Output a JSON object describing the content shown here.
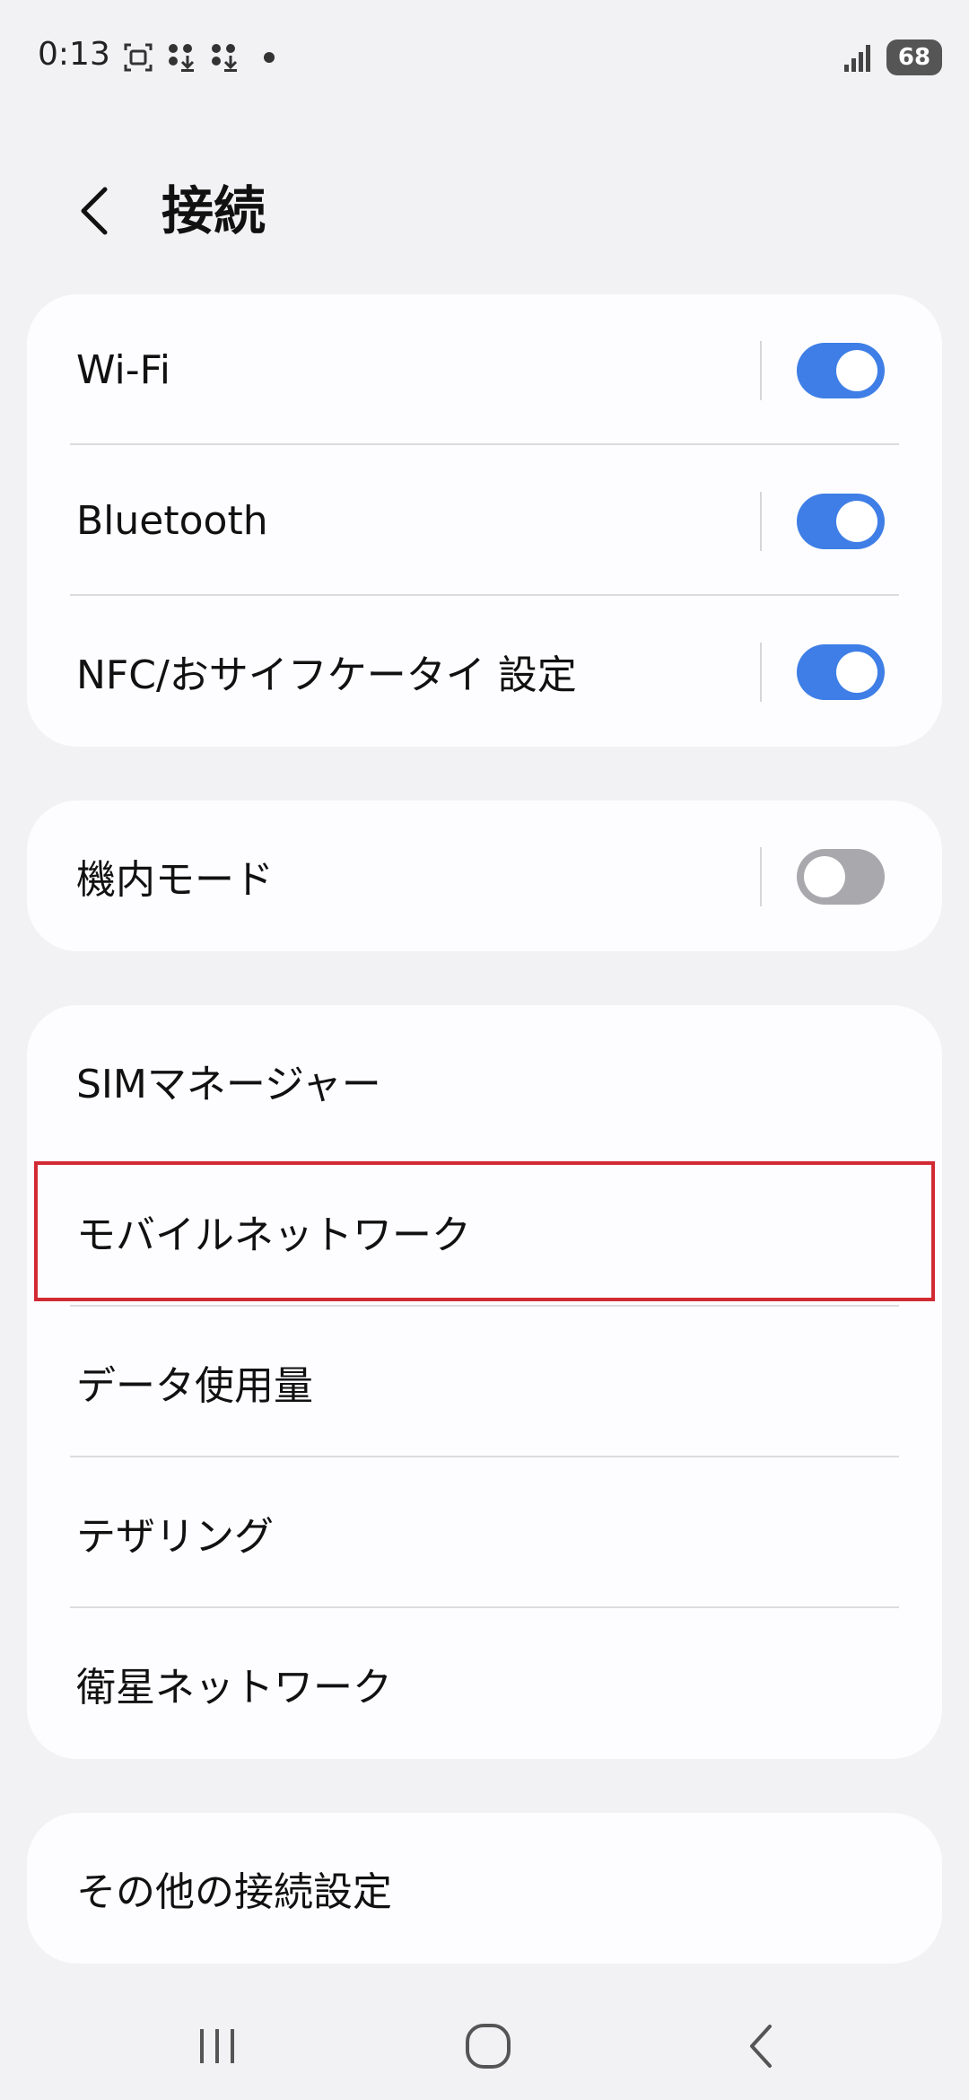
{
  "status_bar": {
    "time": "0:13",
    "battery": "68"
  },
  "header": {
    "title": "接続"
  },
  "groups": [
    {
      "items": [
        {
          "label": "Wi-Fi",
          "toggle": true
        },
        {
          "label": "Bluetooth",
          "toggle": true
        },
        {
          "label": "NFC/おサイフケータイ 設定",
          "toggle": true
        }
      ]
    },
    {
      "items": [
        {
          "label": "機内モード",
          "toggle": false
        }
      ]
    },
    {
      "items": [
        {
          "label": "SIMマネージャー"
        },
        {
          "label": "モバイルネットワーク",
          "highlighted": true
        },
        {
          "label": "データ使用量"
        },
        {
          "label": "テザリング"
        },
        {
          "label": "衛星ネットワーク"
        }
      ]
    },
    {
      "items": [
        {
          "label": "その他の接続設定"
        }
      ]
    }
  ],
  "colors": {
    "toggle_on": "#3e7ee6",
    "toggle_off": "#a8a8ad",
    "highlight": "#d22a33",
    "background": "#f2f2f4",
    "card": "#fdfdff"
  },
  "nav": {
    "icons": [
      "recent-apps-icon",
      "home-icon",
      "back-icon"
    ]
  }
}
